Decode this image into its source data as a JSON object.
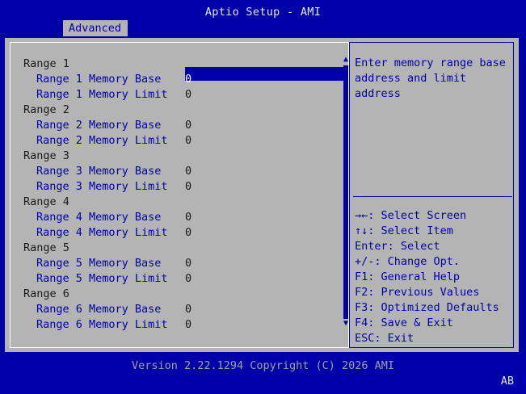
{
  "app": {
    "title": "Aptio Setup - AMI"
  },
  "tabs": [
    {
      "label": "Advanced",
      "active": true
    }
  ],
  "settings": [
    {
      "type": "heading",
      "label": "Range 1"
    },
    {
      "type": "item",
      "label": "Range 1 Memory Base",
      "value": "0",
      "selected": true
    },
    {
      "type": "item",
      "label": "Range 1 Memory Limit",
      "value": "0"
    },
    {
      "type": "heading",
      "label": "Range 2"
    },
    {
      "type": "item",
      "label": "Range 2 Memory Base",
      "value": "0"
    },
    {
      "type": "item",
      "label": "Range 2 Memory Limit",
      "value": "0"
    },
    {
      "type": "heading",
      "label": "Range 3"
    },
    {
      "type": "item",
      "label": "Range 3 Memory Base",
      "value": "0"
    },
    {
      "type": "item",
      "label": "Range 3 Memory Limit",
      "value": "0"
    },
    {
      "type": "heading",
      "label": "Range 4"
    },
    {
      "type": "item",
      "label": "Range 4 Memory Base",
      "value": "0"
    },
    {
      "type": "item",
      "label": "Range 4 Memory Limit",
      "value": "0"
    },
    {
      "type": "heading",
      "label": "Range 5"
    },
    {
      "type": "item",
      "label": "Range 5 Memory Base",
      "value": "0"
    },
    {
      "type": "item",
      "label": "Range 5 Memory Limit",
      "value": "0"
    },
    {
      "type": "heading",
      "label": "Range 6"
    },
    {
      "type": "item",
      "label": "Range 6 Memory Base",
      "value": "0"
    },
    {
      "type": "item",
      "label": "Range 6 Memory Limit",
      "value": "0"
    }
  ],
  "scrollbar": {
    "up_icon": "▲",
    "down_icon": "▼"
  },
  "help": {
    "text": "Enter memory range base address and limit address"
  },
  "keys": [
    "→←: Select Screen",
    "↑↓: Select Item",
    "Enter: Select",
    "+/-: Change Opt.",
    "F1: General Help",
    "F2: Previous Values",
    "F3: Optimized Defaults",
    "F4: Save & Exit",
    "ESC: Exit"
  ],
  "footer": {
    "version": "Version 2.22.1294 Copyright (C) 2026 AMI",
    "badge": "AB"
  },
  "colors": {
    "blue": "#0000a8",
    "gray": "#b4b4b4",
    "white": "#ffffff"
  }
}
